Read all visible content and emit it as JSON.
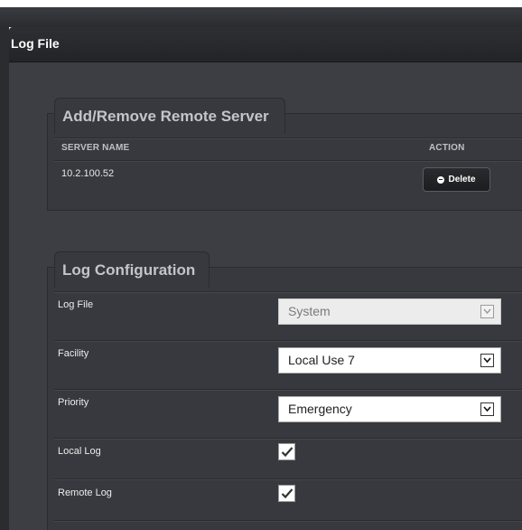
{
  "dialog": {
    "title": "Log File"
  },
  "remote_server_panel": {
    "title": "Add/Remove Remote Server",
    "columns": [
      "SERVER NAME",
      "ACTION"
    ],
    "rows": [
      {
        "server_name": "10.2.100.52",
        "action_label": "Delete",
        "action_icon": "minus-circle-icon"
      }
    ]
  },
  "log_config_panel": {
    "title": "Log Configuration",
    "fields": [
      {
        "label": "Log File",
        "value": "System",
        "type": "select",
        "disabled": true
      },
      {
        "label": "Facility",
        "value": "Local Use 7",
        "type": "select",
        "disabled": false
      },
      {
        "label": "Priority",
        "value": "Emergency",
        "type": "select",
        "disabled": false
      },
      {
        "label": "Local Log",
        "checked": true,
        "type": "checkbox"
      },
      {
        "label": "Remote Log",
        "checked": true,
        "type": "checkbox"
      }
    ]
  },
  "colors": {
    "dialog_background": "#3d3e43",
    "panel_background": "#38393e",
    "header_background": "#232427",
    "title_text": "#ffffff",
    "panel_title_text": "#c4c5c9"
  }
}
